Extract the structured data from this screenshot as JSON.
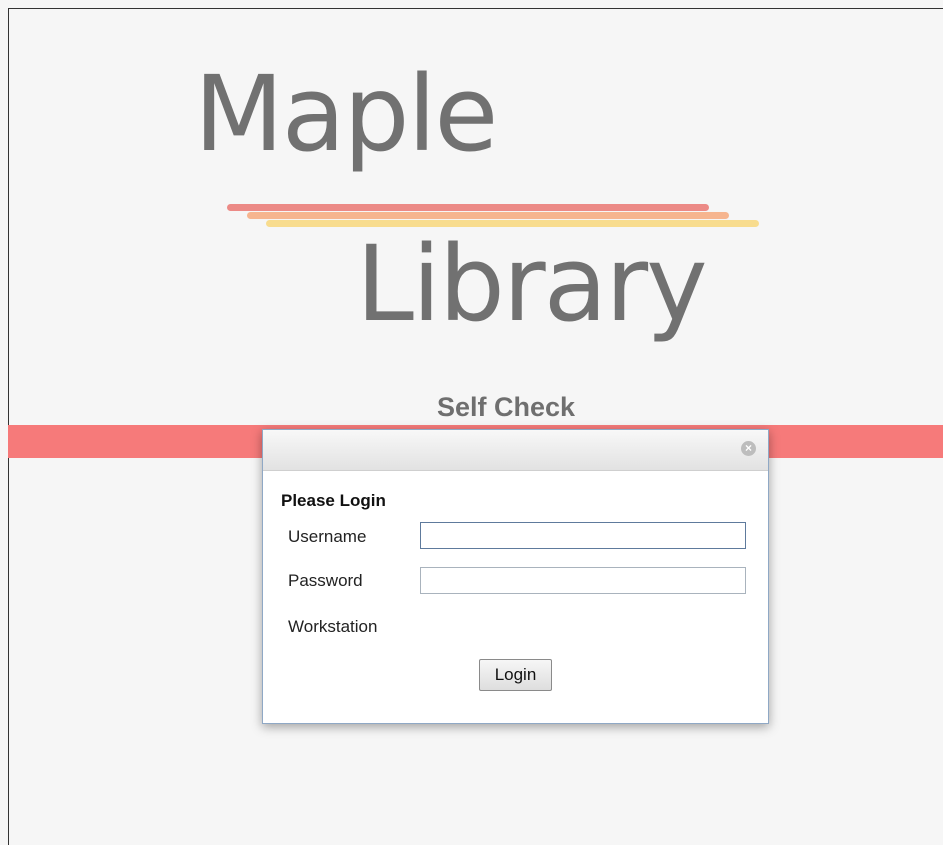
{
  "logo": {
    "line1": "Maple",
    "line2": "Library",
    "stripe_colors": [
      "#ec8a86",
      "#f6b58f",
      "#f8dc8e"
    ]
  },
  "subtitle": "Self Check",
  "band_color": "#f67a7a",
  "dialog": {
    "close_icon": "close-icon",
    "close_glyph": "×",
    "heading": "Please Login",
    "fields": {
      "username_label": "Username",
      "username_value": "",
      "password_label": "Password",
      "password_value": "",
      "workstation_label": "Workstation"
    },
    "login_button": "Login"
  }
}
